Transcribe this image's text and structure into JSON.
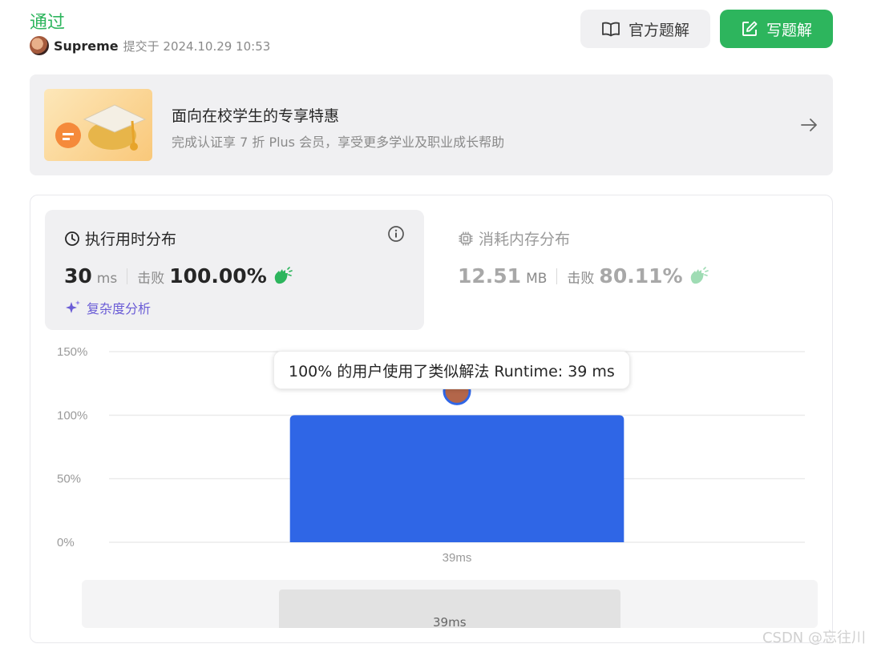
{
  "header": {
    "status": "通过",
    "user": "Supreme",
    "submitted_text": "提交于 2024.10.29 10:53",
    "official_button": "官方题解",
    "write_button": "写题解"
  },
  "promo": {
    "title": "面向在校学生的专享特惠",
    "subtitle": "完成认证享 7 折 Plus 会员，享受更多学业及职业成长帮助"
  },
  "runtime": {
    "tab_title": "执行用时分布",
    "value": "30",
    "unit": "ms",
    "beat_label": "击败",
    "beat_pct": "100.00%",
    "complexity": "复杂度分析"
  },
  "memory": {
    "tab_title": "消耗内存分布",
    "value": "12.51",
    "unit": "MB",
    "beat_label": "击败",
    "beat_pct": "80.11%"
  },
  "tooltip": "100% 的用户使用了类似解法 Runtime: 39 ms",
  "chart_data": {
    "type": "bar",
    "categories": [
      "39ms"
    ],
    "values": [
      100
    ],
    "yticks": [
      "0%",
      "50%",
      "100%",
      "150%"
    ],
    "ylim": [
      0,
      150
    ],
    "grid": true,
    "bar_color": "#2f66e6"
  },
  "brush_label": "39ms",
  "watermark": "CSDN @忘往川",
  "colors": {
    "accent_green": "#2db55d",
    "bar_blue": "#2f66e6",
    "complexity_purple": "#6a5cd6"
  }
}
